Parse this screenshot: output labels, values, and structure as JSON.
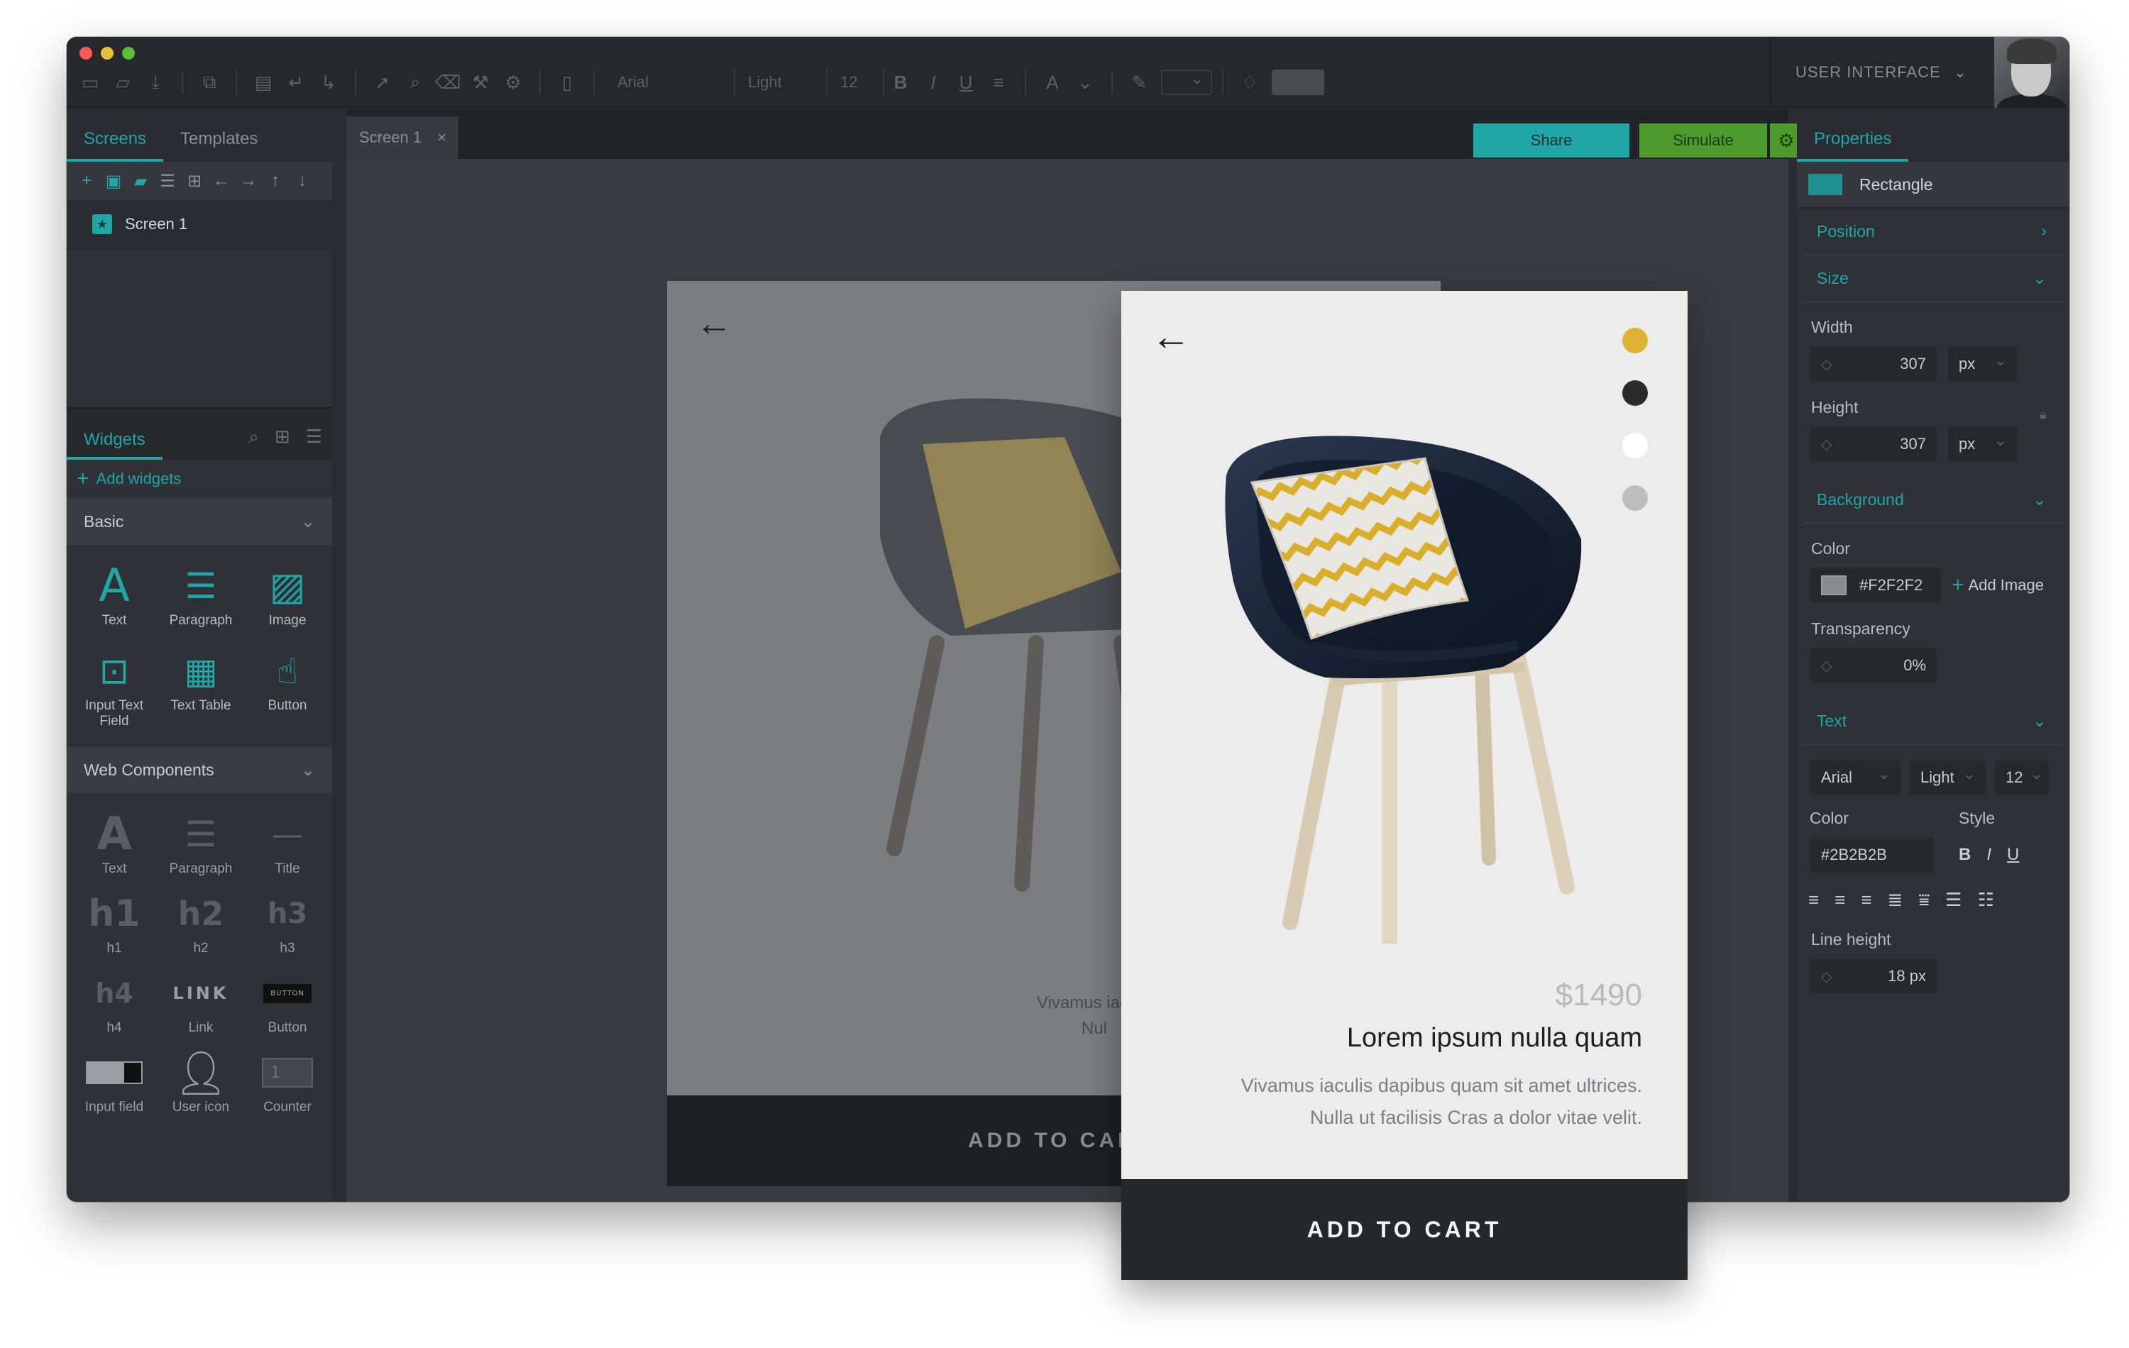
{
  "toolbar": {
    "font_family": "Arial",
    "font_weight": "Light",
    "font_size": "12",
    "bold": "B",
    "italic": "I",
    "underline": "U"
  },
  "ui_mode": "USER INTERFACE",
  "left_panel": {
    "tabs": [
      "Screens",
      "Templates"
    ],
    "screens": [
      {
        "label": "Screen 1"
      }
    ],
    "widgets_tab": "Widgets",
    "add_widgets": "Add widgets",
    "basic_section": "Basic",
    "basic_widgets": [
      "Text",
      "Paragraph",
      "Image",
      "Input Text Field",
      "Text Table",
      "Button"
    ],
    "web_section": "Web Components",
    "web_widgets": [
      "Text",
      "Paragraph",
      "Title",
      "h1",
      "h2",
      "h3",
      "h4",
      "Link",
      "Button",
      "Input field",
      "User icon",
      "Counter"
    ],
    "web_icons": {
      "h1": "h1",
      "h2": "h2",
      "h3": "h3",
      "h4": "h4",
      "link": "LINK",
      "button": "BUTTON",
      "counter": "1"
    }
  },
  "canvas": {
    "tab_label": "Screen 1",
    "share_label": "Share",
    "simulate_label": "Simulate",
    "bg_preview_text_1": "Vivamus iac",
    "bg_preview_text_2": "Nul",
    "bg_preview_cart": "ADD TO CAR"
  },
  "right_panel": {
    "tab": "Properties",
    "element_type": "Rectangle",
    "position_label": "Position",
    "size_label": "Size",
    "width_label": "Width",
    "width_value": "307",
    "width_unit": "px",
    "height_label": "Height",
    "height_value": "307",
    "height_unit": "px",
    "background_label": "Background",
    "color_label": "Color",
    "bg_color_value": "#F2F2F2",
    "add_image": "Add Image",
    "transparency_label": "Transparency",
    "transparency_value": "0%",
    "text_label": "Text",
    "font_family": "Arial",
    "font_weight": "Light",
    "font_size": "12",
    "text_color_label": "Color",
    "style_label": "Style",
    "text_color_value": "#2B2B2B",
    "bold": "B",
    "italic": "I",
    "underline": "U",
    "line_height_label": "Line height",
    "line_height_value": "18 px"
  },
  "product": {
    "price": "$1490",
    "title": "Lorem ipsum nulla quam",
    "description_line1": "Vivamus iaculis dapibus quam sit amet ultrices.",
    "description_line2": "Nulla ut facilisis Cras a dolor vitae velit.",
    "cta": "ADD TO CART",
    "color_swatches": [
      "#E0B233",
      "#2B2B2B",
      "#FFFFFF",
      "#BDBDBD"
    ]
  },
  "colors": {
    "accent": "#1FA6A6",
    "simulate": "#4D9B2C",
    "window_bg": "#2A2C31"
  }
}
